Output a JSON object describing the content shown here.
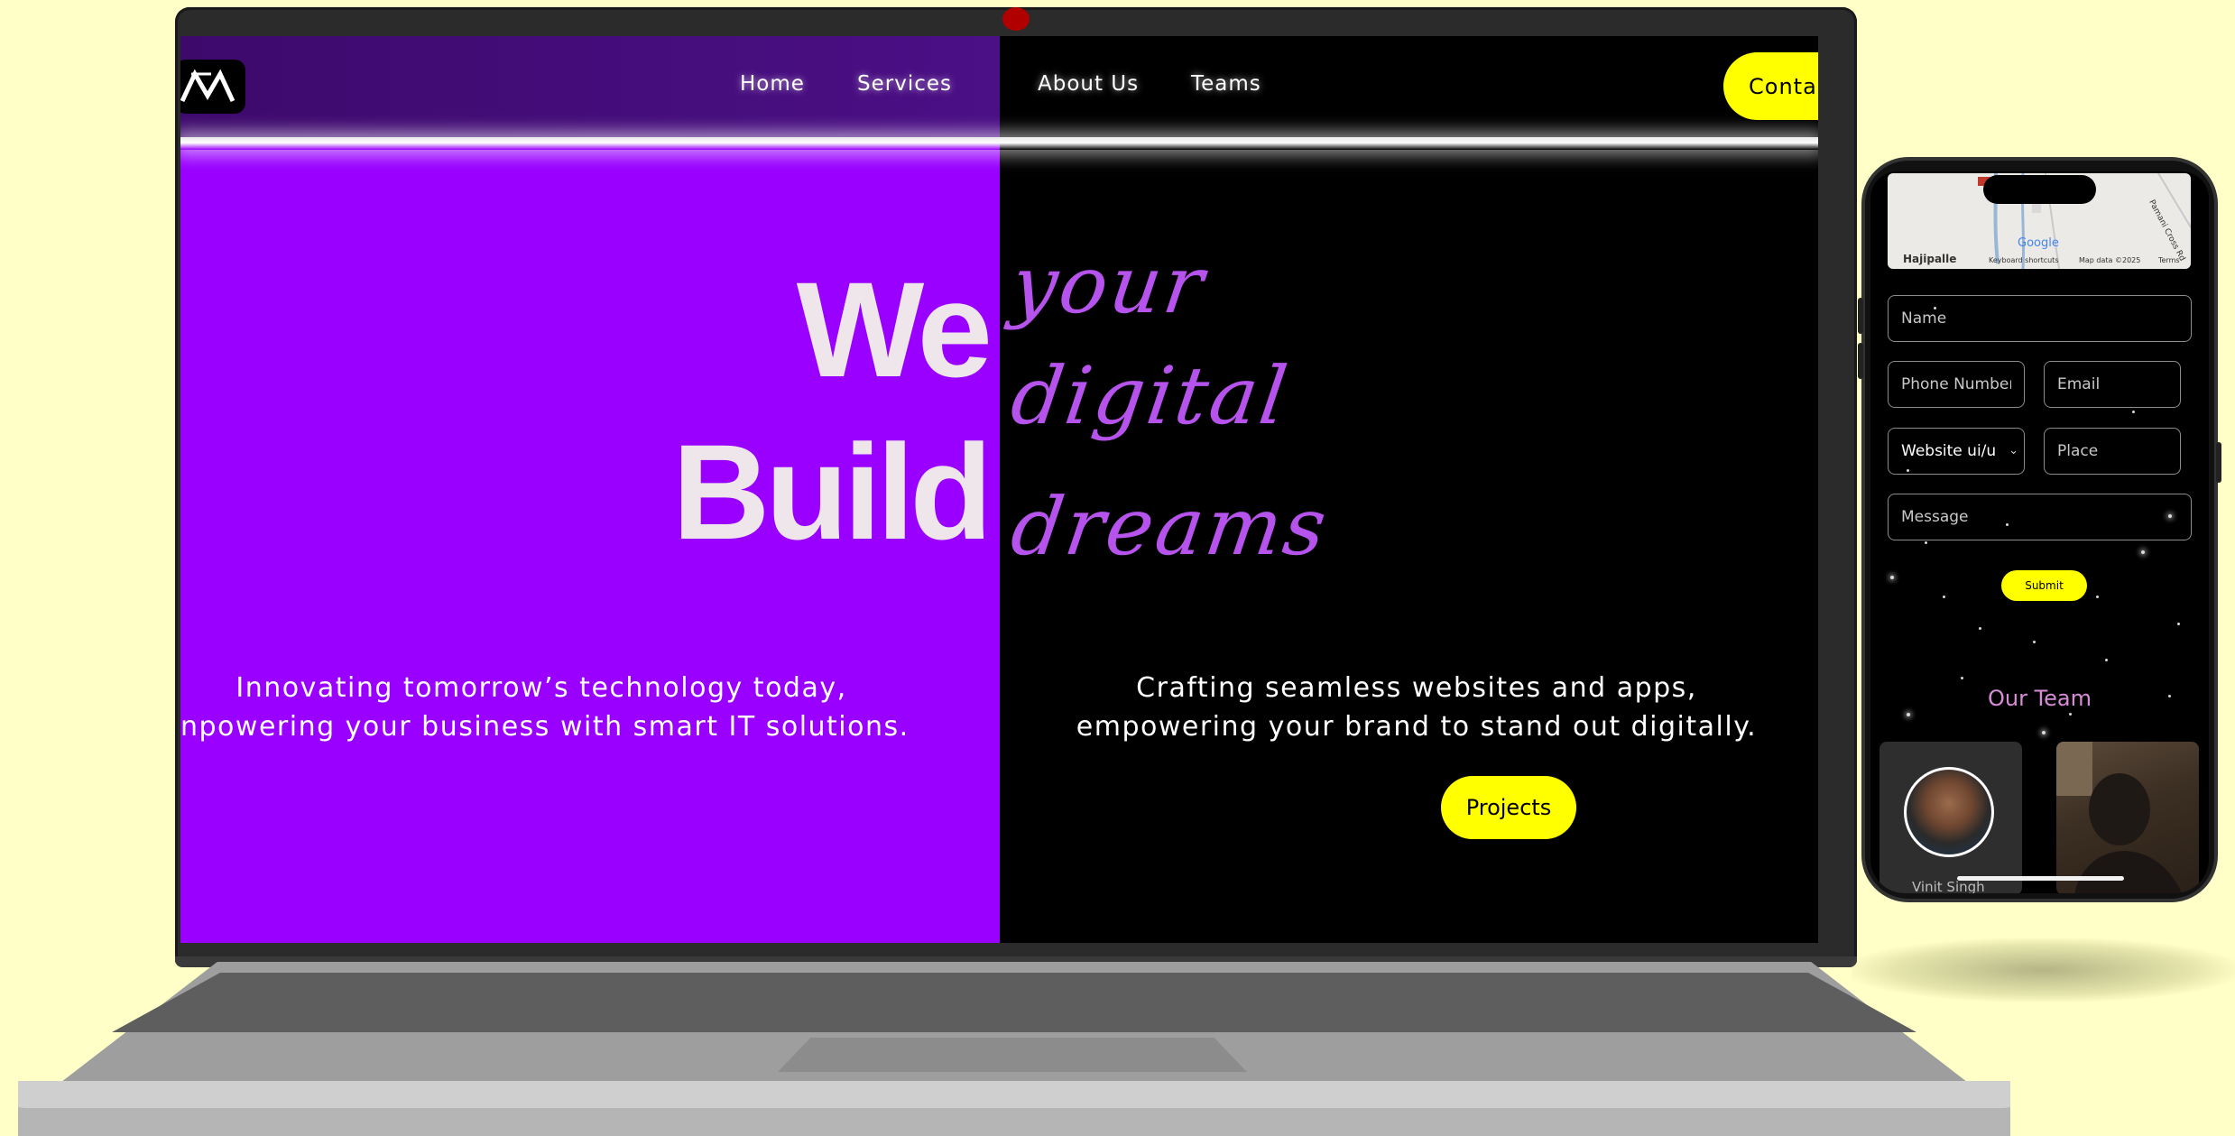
{
  "brand": {
    "logo_text": "M"
  },
  "nav": {
    "links": [
      "Home",
      "Services",
      "About Us",
      "Teams"
    ],
    "contact_label": "Conta"
  },
  "hero": {
    "line1": "We",
    "line2": "Build",
    "script1": "your",
    "script2": "digital",
    "script3": "dreams"
  },
  "taglines": {
    "left_line1": "Innovating tomorrow’s technology today,",
    "left_line2": "npowering your business with smart IT solutions.",
    "right_line1": "Crafting seamless websites and apps,",
    "right_line2": "empowering your brand to stand out digitally."
  },
  "buttons": {
    "projects": "Projects",
    "submit": "Submit"
  },
  "map": {
    "place": "Hajipalle",
    "logo": "Google",
    "shortcuts": "Keyboard shortcuts",
    "data": "Map data ©2025",
    "terms": "Terms",
    "road": "Pamani Cross Rd"
  },
  "form": {
    "name_placeholder": "Name",
    "phone_placeholder": "Phone Number",
    "email_placeholder": "Email",
    "service_value": "Website ui/u",
    "place_placeholder": "Place",
    "message_placeholder": "Message"
  },
  "team": {
    "title": "Our Team",
    "member1_name": "Vinit Singh"
  },
  "colors": {
    "background": "#ffffc7",
    "purple": "#9900ff",
    "accent_yellow": "#ffff00",
    "script_purple": "#b653ec",
    "team_title": "#d78cd8"
  }
}
